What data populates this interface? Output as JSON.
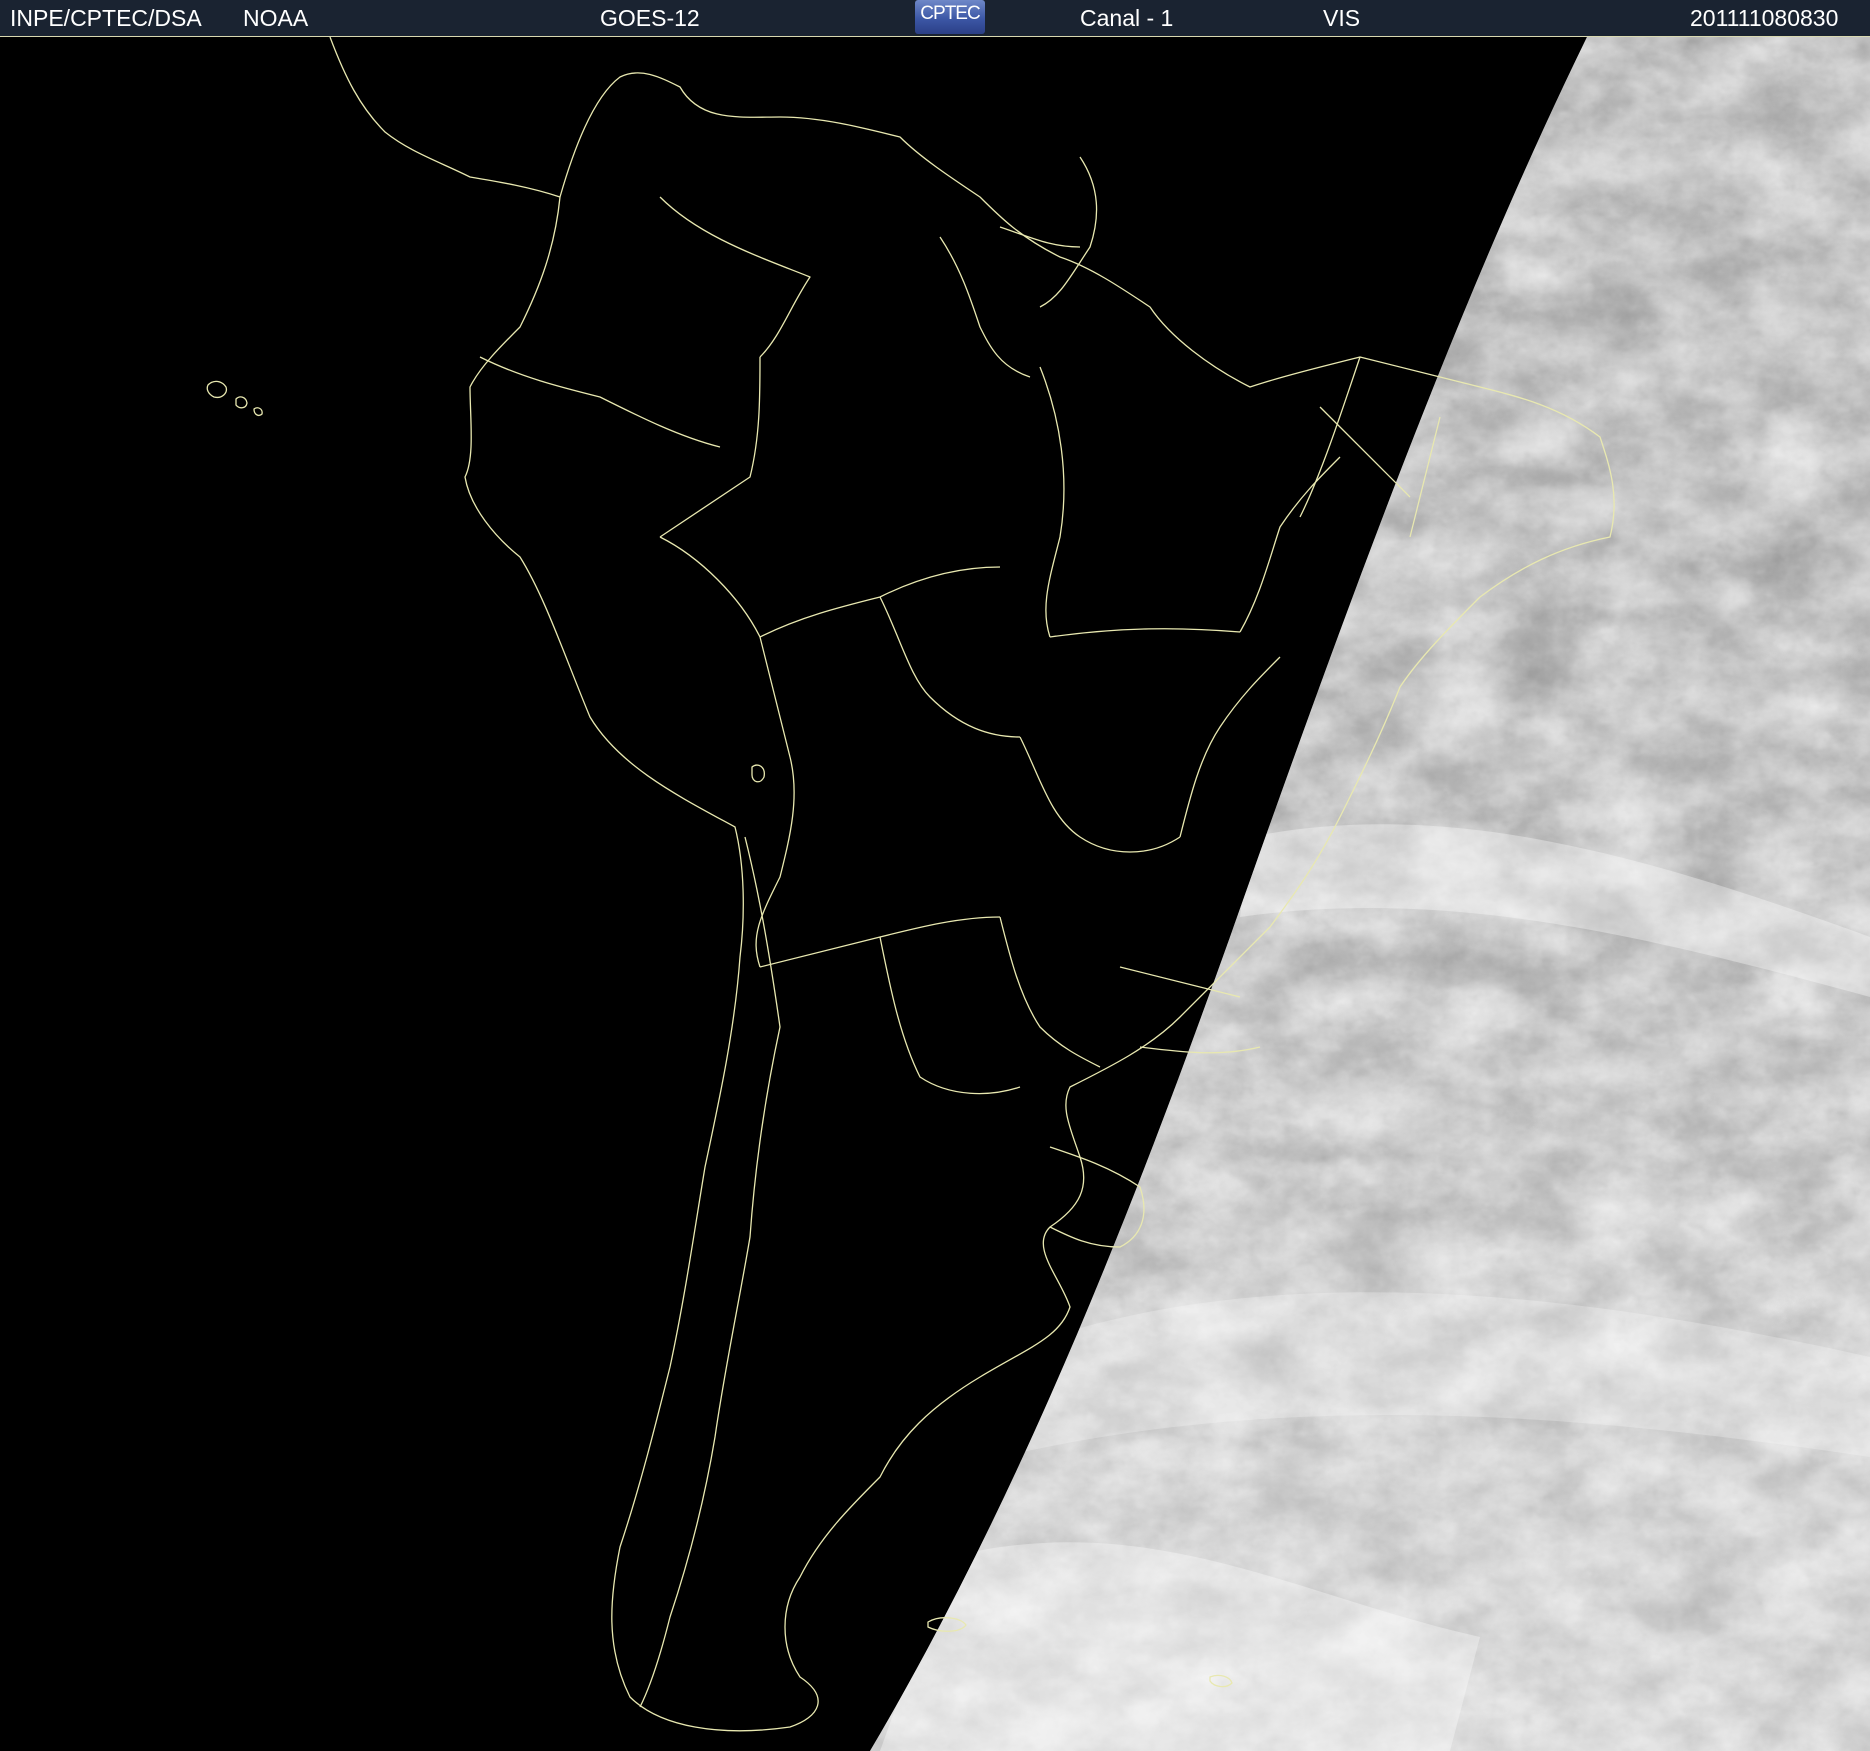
{
  "header": {
    "source": "INPE/CPTEC/DSA",
    "agency": "NOAA",
    "satellite": "GOES-12",
    "logo": "CPTEC",
    "channel": "Canal - 1",
    "band": "VIS",
    "timestamp": "201111080830"
  },
  "colors": {
    "header_bg": "#1a2331",
    "boundary_lines": "#e8e8b0",
    "night_side": "#000000",
    "cloud_light": "#e6e6e6",
    "surface_dark": "#5a5a5a"
  },
  "map": {
    "projection": "geostationary",
    "region": "South America",
    "terminator": "day-night boundary shown"
  }
}
